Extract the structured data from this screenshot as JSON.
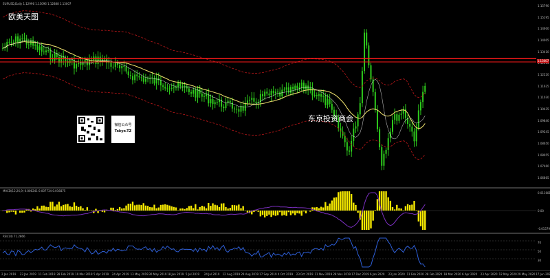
{
  "panes": {
    "main": {
      "header": "EURUSD,Daily  1.12996  1.13096  1.12888  1.13007"
    },
    "macd": {
      "header": "MACD(12,26,9)  0.006241  0.007734  0.016875"
    },
    "rsi": {
      "header": "RSI(14)  71.2866"
    }
  },
  "overlay": {
    "title": "欧美天图",
    "watermark": "东京投资商会",
    "qr_caption_line1": "微信公众号",
    "qr_caption_line2": "Tokyo-TZ"
  },
  "price_axis": [
    "1.15790",
    "1.15195",
    "1.14600",
    "1.14005",
    "1.13410",
    "1.12815",
    "1.12220",
    "1.11625",
    "1.11030",
    "1.10435",
    "1.09840",
    "1.09245",
    "1.08650",
    "1.08055",
    "1.07460",
    "1.06865"
  ],
  "current_price": "1.13007",
  "macd_axis": [
    "0.011681",
    "0.00",
    "-0.015795"
  ],
  "rsi_axis": [
    "70",
    "50",
    "30"
  ],
  "date_axis": [
    "2 Jan 2019",
    "23 Jan 2019",
    "11 Feb 2019",
    "28 Feb 2019",
    "19 Mar 2019",
    "5 Apr 2019",
    "24 Apr 2019",
    "13 May 2019",
    "30 May 2019",
    "18 Jun 2019",
    "5 Jul 2019",
    "24 Jul 2019",
    "12 Aug 2019",
    "29 Aug 2019",
    "17 Sep 2019",
    "4 Oct 2019",
    "23 Oct 2019",
    "11 Nov 2019",
    "28 Nov 2019",
    "17 Dec 2019",
    "6 Jan 2020",
    "23 Jan 2020",
    "11 Feb 2020",
    "28 Feb 2020",
    "18 Mar 2020",
    "6 Apr 2020",
    "23 Apr 2020",
    "12 May 2020",
    "29 May 2020",
    "17 Jun 2020"
  ],
  "colors": {
    "background": "#000000",
    "candle": "#2ecc1c",
    "bands": "#c2181a",
    "ma": "#e6d96a",
    "signal": "#ffffff",
    "macd_hist": "#f5e800",
    "macd_line": "#7a2fbf",
    "rsi_line": "#2e5fd8",
    "level_line": "#ff1a1a"
  }
}
